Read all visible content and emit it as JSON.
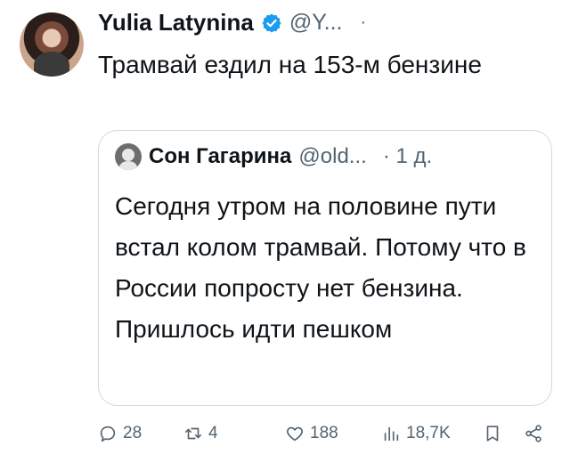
{
  "tweet": {
    "author_name": "Yulia Latynina",
    "author_handle": "@Y...",
    "text": "Трамвай ездил на 153-м бензине"
  },
  "quote": {
    "author_name": "Сон Гагарина",
    "author_handle": "@old...",
    "time": "· 1 д.",
    "text": "Сегодня утром на половине пути встал колом трамвай. Потому что в России попросту нет бензина. Пришлось идти пешком"
  },
  "actions": {
    "replies": "28",
    "retweets": "4",
    "likes": "188",
    "views": "18,7K"
  },
  "colors": {
    "verified": "#1d9bf0",
    "secondary": "#536471",
    "border": "#cfd9de"
  },
  "icons": [
    "verified-badge-icon",
    "reply-icon",
    "retweet-icon",
    "like-icon",
    "views-icon",
    "bookmark-icon",
    "share-icon"
  ]
}
